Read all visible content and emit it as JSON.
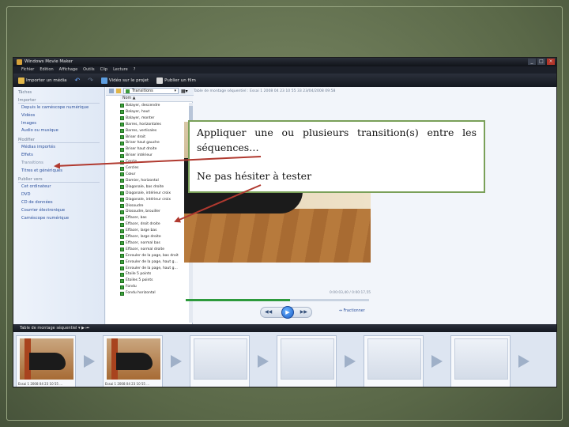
{
  "window": {
    "title": "Windows Movie Maker",
    "controls": [
      "_",
      "□",
      "×"
    ]
  },
  "menu": [
    "Fichier",
    "Edition",
    "Affichage",
    "Outils",
    "Clip",
    "Lecture",
    "?"
  ],
  "toolbar": {
    "import_label": "Importer un média",
    "undo_label": "↶",
    "redo_label": "↷",
    "publish_label": "Vidéo sur le projet",
    "publish_movie_label": "Publier un film"
  },
  "taskpane": {
    "title": "Tâches",
    "sections": [
      {
        "name": "Importer",
        "items": [
          {
            "label": "Depuis le caméscope numérique",
            "dim": false
          },
          {
            "label": "Vidéos",
            "dim": false
          },
          {
            "label": "Images",
            "dim": false
          },
          {
            "label": "Audio ou musique",
            "dim": false
          }
        ]
      },
      {
        "name": "Modifier",
        "items": [
          {
            "label": "Médias importés",
            "dim": false
          },
          {
            "label": "Effets",
            "dim": false
          },
          {
            "label": "Transitions",
            "dim": true
          },
          {
            "label": "Titres et génériques",
            "dim": false
          }
        ]
      },
      {
        "name": "Publier vers",
        "items": [
          {
            "label": "Cet ordinateur",
            "dim": false
          },
          {
            "label": "DVD",
            "dim": false
          },
          {
            "label": "CD de données",
            "dim": false
          },
          {
            "label": "Courrier électronique",
            "dim": false
          },
          {
            "label": "Caméscope numérique",
            "dim": false
          }
        ]
      }
    ]
  },
  "transitions_panel": {
    "dropdown_value": "Transitions",
    "column_header": "Nom ▲",
    "items": [
      "Balayer, descendre",
      "Balayer, haut",
      "Balayer, monter",
      "Barres, horizontales",
      "Barres, verticales",
      "Briser droit",
      "Briser haut gauche",
      "Briser haut droite",
      "Briser intérieur",
      "Cercle",
      "Cercles",
      "Cœur",
      "Damier, horizontal",
      "Diagonale, bas droite",
      "Diagonale, intérieur croix",
      "Diagonale, intérieur croix",
      "Dissoudre",
      "Dissoudre, brouiller",
      "Effacer, bas",
      "Effacer, droit droite",
      "Effacer, large bas",
      "Effacer, large droite",
      "Effacer, normal bas",
      "Effacer, normal droite",
      "Enrouler de la page, bas droit",
      "Enrouler de la page, haut g...",
      "Enrouler de la page, haut g...",
      "Étoile 5 points",
      "Étoiles 5 points",
      "Fondu",
      "Fondu horizontal"
    ]
  },
  "preview": {
    "label": "Table de montage séquentiel : Essai 1 2008 04 23 10 55 33 23/04/2008 09:58",
    "timecode": "0:00:03,40 / 0:00:17,55",
    "progress": 0.57,
    "prev_icon": "◀◀",
    "play_icon": "▶",
    "next_icon": "▶▶",
    "split_label": "Fractionner"
  },
  "storyboard": {
    "bar_label": "Table de montage séquentiel ▾   ▶   ⏮",
    "clips": [
      {
        "caption": "Essai 1 2008 04 23 10 55 ...",
        "empty": false
      },
      {
        "caption": "Essai 1 2008 04 23 10 55 ...",
        "empty": false
      },
      {
        "caption": "",
        "empty": true
      },
      {
        "caption": "",
        "empty": true
      },
      {
        "caption": "",
        "empty": true
      },
      {
        "caption": "",
        "empty": true
      }
    ]
  },
  "callout": {
    "paragraph1_line1": "Appliquer une ou plusieurs transition(s) entre les",
    "paragraph1_line2": "séquences…",
    "paragraph2": "Ne pas hésiter à tester"
  },
  "colors": {
    "slide_bg": "#5d6b4b",
    "callout_border": "#7aa059",
    "arrow": "#b0392f",
    "transition_icon": "#3da23d"
  }
}
